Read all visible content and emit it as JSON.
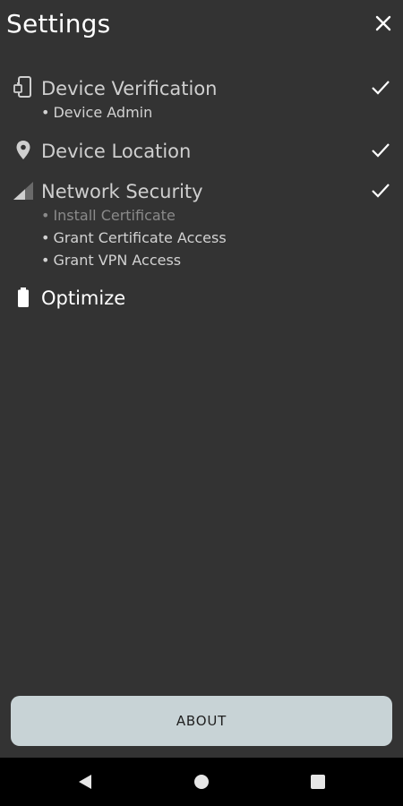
{
  "header": {
    "title": "Settings",
    "close_icon": "close-icon"
  },
  "sections": [
    {
      "label": "Device Verification",
      "icon": "phone-admin-icon",
      "checked": true,
      "sub_items": [
        "Device Admin"
      ]
    },
    {
      "label": "Device Location",
      "icon": "location-pin-icon",
      "checked": true,
      "sub_items": []
    },
    {
      "label": "Network Security",
      "icon": "signal-icon",
      "checked": true,
      "sub_items": [
        "Install Certificate",
        "Grant Certificate Access",
        "Grant VPN Access"
      ]
    },
    {
      "label": "Optimize",
      "icon": "battery-icon",
      "checked": false,
      "sub_items": []
    }
  ],
  "footer": {
    "about_label": "ABOUT"
  },
  "navbar": {
    "back_icon": "back-icon",
    "home_icon": "home-icon",
    "recents_icon": "recents-icon"
  },
  "colors": {
    "background": "#333333",
    "button": "#c8d3d6",
    "navbar": "#000000"
  }
}
